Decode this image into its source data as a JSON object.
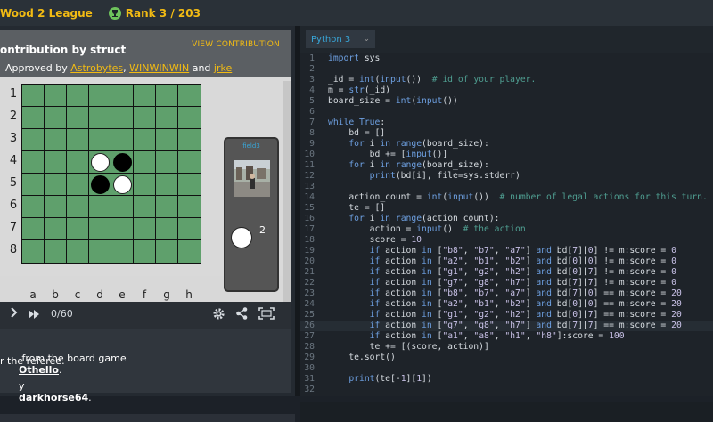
{
  "header": {
    "league": "Wood 2 League",
    "rank": "Rank 3 / 203"
  },
  "contribution": {
    "title": "ontribution by struct",
    "view_link": "VIEW CONTRIBUTION",
    "approved_prefix": "Approved by",
    "approvers": [
      "Astrobytes",
      "WINWINWIN",
      "jrke"
    ],
    "sep1": ",",
    "sep2": ",",
    "and_word": "and"
  },
  "board": {
    "row_labels": [
      "1",
      "2",
      "3",
      "4",
      "5",
      "6",
      "7",
      "8"
    ],
    "col_labels": [
      "a",
      "b",
      "c",
      "d",
      "e",
      "f",
      "g",
      "h"
    ]
  },
  "player": {
    "name": "field3",
    "score": "2"
  },
  "replay": {
    "frame": "0/60"
  },
  "description": {
    "line1_prefix": " from the board game",
    "line1_link": "Othello",
    "line1_suffix": ".",
    "line2": "r the referee.",
    "line3_prefix": "y",
    "line3_link": "darkhorse64",
    "line3_suffix": "."
  },
  "editor": {
    "language": "Python 3",
    "active_line": 26,
    "lines": [
      {
        "n": "1",
        "code": "import sys"
      },
      {
        "n": "2",
        "code": ""
      },
      {
        "n": "3",
        "code": "_id = int(input())  # id of your player."
      },
      {
        "n": "4",
        "code": "m = str(_id)"
      },
      {
        "n": "5",
        "code": "board_size = int(input())"
      },
      {
        "n": "6",
        "code": ""
      },
      {
        "n": "7",
        "code": "while True:"
      },
      {
        "n": "8",
        "code": "    bd = []"
      },
      {
        "n": "9",
        "code": "    for i in range(board_size):"
      },
      {
        "n": "10",
        "code": "        bd += [input()]"
      },
      {
        "n": "11",
        "code": "    for i in range(board_size):"
      },
      {
        "n": "12",
        "code": "        print(bd[i], file=sys.stderr)"
      },
      {
        "n": "13",
        "code": ""
      },
      {
        "n": "14",
        "code": "    action_count = int(input())  # number of legal actions for this turn."
      },
      {
        "n": "15",
        "code": "    te = []"
      },
      {
        "n": "16",
        "code": "    for i in range(action_count):"
      },
      {
        "n": "17",
        "code": "        action = input()  # the action"
      },
      {
        "n": "18",
        "code": "        score = 10"
      },
      {
        "n": "19",
        "code": "        if action in [\"b8\", \"b7\", \"a7\"] and bd[7][0] != m:score = 0"
      },
      {
        "n": "20",
        "code": "        if action in [\"a2\", \"b1\", \"b2\"] and bd[0][0] != m:score = 0"
      },
      {
        "n": "21",
        "code": "        if action in [\"g1\", \"g2\", \"h2\"] and bd[0][7] != m:score = 0"
      },
      {
        "n": "22",
        "code": "        if action in [\"g7\", \"g8\", \"h7\"] and bd[7][7] != m:score = 0"
      },
      {
        "n": "23",
        "code": "        if action in [\"b8\", \"b7\", \"a7\"] and bd[7][0] == m:score = 20"
      },
      {
        "n": "24",
        "code": "        if action in [\"a2\", \"b1\", \"b2\"] and bd[0][0] == m:score = 20"
      },
      {
        "n": "25",
        "code": "        if action in [\"g1\", \"g2\", \"h2\"] and bd[0][7] == m:score = 20"
      },
      {
        "n": "26",
        "code": "        if action in [\"g7\", \"g8\", \"h7\"] and bd[7][7] == m:score = 20"
      },
      {
        "n": "27",
        "code": "        if action in [\"a1\", \"a8\", \"h1\", \"h8\"]:score = 100"
      },
      {
        "n": "28",
        "code": "        te += [(score, action)]"
      },
      {
        "n": "29",
        "code": "    te.sort()"
      },
      {
        "n": "30",
        "code": ""
      },
      {
        "n": "31",
        "code": "    print(te[-1][1])"
      },
      {
        "n": "32",
        "code": ""
      }
    ]
  },
  "colors": {
    "accent": "#f2bb13",
    "board_green": "#5fa06c",
    "link_blue": "#38a6d8"
  }
}
